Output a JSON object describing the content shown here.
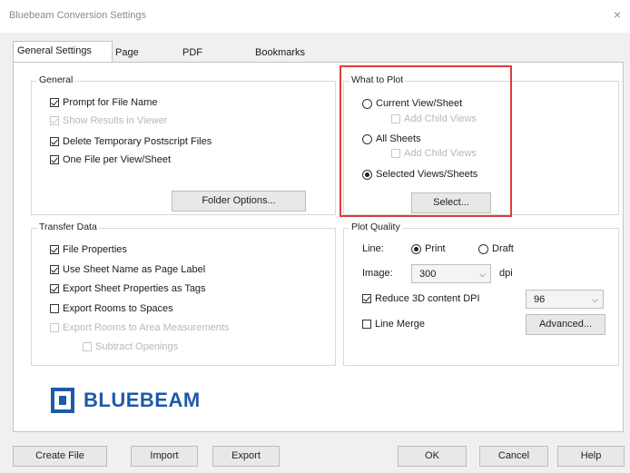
{
  "window": {
    "title": "Bluebeam Conversion Settings",
    "close_glyph": "×"
  },
  "tabs": [
    {
      "label": "General Settings",
      "active": true
    },
    {
      "label": "Page Setup"
    },
    {
      "label": "PDF Security"
    },
    {
      "label": "Bookmarks"
    }
  ],
  "general": {
    "title": "General",
    "prompt_filename": {
      "label": "Prompt for File Name",
      "checked": true
    },
    "show_results": {
      "label": "Show Results in Viewer",
      "checked": true,
      "disabled": true
    },
    "delete_temp": {
      "label": "Delete Temporary Postscript Files",
      "checked": true
    },
    "one_file": {
      "label": "One File per View/Sheet",
      "checked": true
    },
    "folder_options": "Folder Options..."
  },
  "what_to_plot": {
    "title": "What to Plot",
    "current_view": "Current View/Sheet",
    "add_child_1": "Add Child Views",
    "all_sheets": "All Sheets",
    "add_child_2": "Add Child Views",
    "selected_views": "Selected Views/Sheets",
    "select_button": "Select..."
  },
  "transfer": {
    "title": "Transfer Data",
    "file_props": {
      "label": "File Properties",
      "checked": true
    },
    "sheet_name": {
      "label": "Use Sheet Name as Page Label",
      "checked": true
    },
    "export_sheet": {
      "label": "Export Sheet Properties as Tags",
      "checked": true
    },
    "export_rooms": {
      "label": "Export Rooms to Spaces",
      "checked": false
    },
    "export_rooms_area": {
      "label": "Export Rooms to Area Measurements",
      "checked": false,
      "disabled": true
    },
    "subtract": {
      "label": "Subtract Openings",
      "checked": false,
      "disabled": true
    }
  },
  "plot_quality": {
    "title": "Plot Quality",
    "line_label": "Line:",
    "print": "Print",
    "draft": "Draft",
    "image_label": "Image:",
    "image_value": "300",
    "dpi_label": "dpi",
    "reduce_3d": {
      "label": "Reduce 3D content DPI",
      "checked": true
    },
    "reduce_value": "96",
    "line_merge": {
      "label": "Line Merge",
      "checked": false
    },
    "advanced": "Advanced..."
  },
  "logo": {
    "text": "BLUEBEAM"
  },
  "buttons": {
    "create_file": "Create File",
    "import": "Import",
    "export": "Export",
    "ok": "OK",
    "cancel": "Cancel",
    "help": "Help"
  },
  "colors": {
    "brand": "#1e5aa8",
    "highlight": "#e03b3b"
  }
}
